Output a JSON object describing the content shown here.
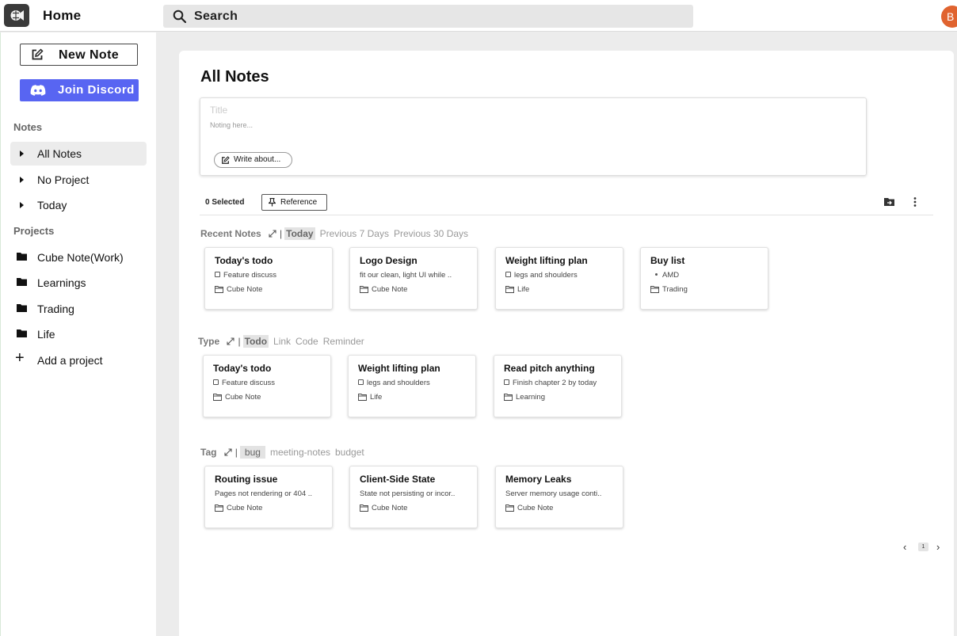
{
  "header": {
    "home_label": "Home",
    "search_placeholder": "Search",
    "avatar_initial": "B",
    "avatar_color": "#e0632f"
  },
  "sidebar": {
    "new_note_label": "New Note",
    "discord_label": "Join Discord",
    "discord_color": "#5865f2",
    "notes_section": "Notes",
    "notes_items": [
      {
        "label": "All Notes",
        "active": true
      },
      {
        "label": "No Project",
        "active": false
      },
      {
        "label": "Today",
        "active": false
      }
    ],
    "projects_section": "Projects",
    "projects": [
      {
        "label": "Cube Note(Work)",
        "icon": "folder-icon"
      },
      {
        "label": "Learnings",
        "icon": "folder-icon"
      },
      {
        "label": "Trading",
        "icon": "folder-icon"
      },
      {
        "label": "Life",
        "icon": "folder-icon"
      }
    ],
    "add_project_label": "Add a project"
  },
  "main": {
    "title": "All Notes",
    "composer": {
      "title_placeholder": "Title",
      "body_placeholder": "Noting here...",
      "write_about_label": "Write about..."
    },
    "selection": {
      "count_label": "0 Selected",
      "reference_label": "Reference"
    },
    "groups": [
      {
        "title": "Recent Notes",
        "options": [
          "Today",
          "Previous 7 Days",
          "Previous 30 Days"
        ],
        "selected": 0,
        "cards": [
          {
            "title": "Today's todo",
            "line": "Feature discuss",
            "line_type": "checkbox",
            "project": "Cube Note"
          },
          {
            "title": "Logo Design",
            "line": "fit our clean, light UI while ..",
            "line_type": "text",
            "project": "Cube Note"
          },
          {
            "title": "Weight lifting plan",
            "line": "legs and shoulders",
            "line_type": "checkbox",
            "project": "Life"
          },
          {
            "title": "Buy list",
            "line": "AMD",
            "line_type": "bullet",
            "project": "Trading"
          }
        ]
      },
      {
        "title": "Type",
        "options": [
          "Todo",
          "Link",
          "Code",
          "Reminder"
        ],
        "selected": 0,
        "cards": [
          {
            "title": "Today's todo",
            "line": "Feature discuss",
            "line_type": "checkbox",
            "project": "Cube Note"
          },
          {
            "title": "Weight lifting plan",
            "line": "legs and shoulders",
            "line_type": "checkbox",
            "project": "Life"
          },
          {
            "title": "Read pitch anything",
            "line": "Finish chapter 2 by today",
            "line_type": "checkbox",
            "project": "Learning"
          }
        ]
      },
      {
        "title": "Tag",
        "options": [
          "bug",
          "meeting-notes",
          "budget"
        ],
        "selected": 0,
        "cards": [
          {
            "title": "Routing issue",
            "line": "Pages not rendering or 404 ..",
            "line_type": "text",
            "project": "Cube Note"
          },
          {
            "title": "Client-Side State",
            "line": "State not persisting or incor..",
            "line_type": "text",
            "project": "Cube Note"
          },
          {
            "title": "Memory Leaks",
            "line": "Server memory usage conti..",
            "line_type": "text",
            "project": "Cube Note"
          }
        ]
      }
    ],
    "pagination": {
      "current_page": "1"
    }
  }
}
